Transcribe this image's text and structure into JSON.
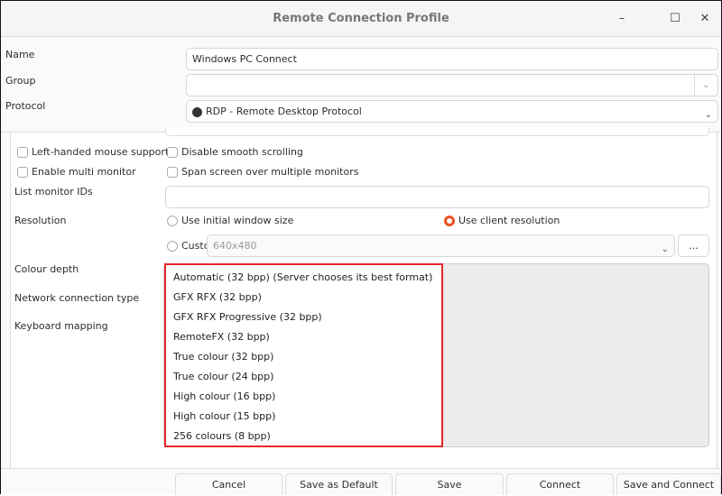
{
  "window": {
    "title": "Remote Connection Profile",
    "minimize": "–",
    "maximize": "☐",
    "close": "✕"
  },
  "form": {
    "name_label": "Name",
    "name_value": "Windows PC Connect",
    "group_label": "Group",
    "group_value": "",
    "protocol_label": "Protocol",
    "protocol_value": "RDP - Remote Desktop Protocol"
  },
  "options": {
    "left_handed": "Left-handed mouse support",
    "disable_smooth": "Disable smooth scrolling",
    "multi_monitor": "Enable multi monitor",
    "span_screen": "Span screen over multiple monitors",
    "monitor_ids_label": "List monitor IDs",
    "monitor_ids_value": "",
    "resolution_label": "Resolution",
    "res_initial": "Use initial window size",
    "res_client": "Use client resolution",
    "res_custom": "Custom",
    "custom_value": "640x480",
    "more_button": "...",
    "selected_resolution": "Use client resolution",
    "colour_depth_label": "Colour depth",
    "network_label": "Network connection type",
    "keyboard_label": "Keyboard mapping"
  },
  "colour_depth_options": [
    "Automatic (32 bpp) (Server chooses its best format)",
    "GFX RFX (32 bpp)",
    "GFX RFX Progressive (32 bpp)",
    "RemoteFX (32 bpp)",
    "True colour (32 bpp)",
    "True colour (24 bpp)",
    "High colour (16 bpp)",
    "High colour (15 bpp)",
    "256 colours (8 bpp)"
  ],
  "buttons": {
    "cancel": "Cancel",
    "save_default": "Save as Default",
    "save": "Save",
    "connect": "Connect",
    "save_connect": "Save and Connect"
  },
  "colors": {
    "accent": "#e95420",
    "highlight": "#e8262c"
  }
}
